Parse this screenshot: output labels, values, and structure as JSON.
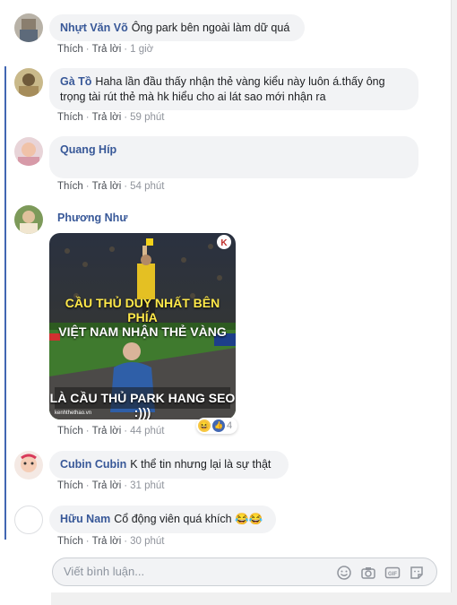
{
  "comments": [
    {
      "name": "Nhựt Văn Võ",
      "text": "Ông park bên ngoài làm dữ quá",
      "like": "Thích",
      "reply": "Trả lời",
      "time": "1 giờ"
    },
    {
      "name": "Gà Tồ",
      "text": "Haha lần đầu thấy nhận thẻ vàng kiểu này luôn á.thấy ông",
      "text2": "trọng tài rút thẻ mà hk hiểu cho ai lát sao mới nhận ra",
      "like": "Thích",
      "reply": "Trả lời",
      "time": "59 phút"
    },
    {
      "name": "Quang Híp",
      "text": "",
      "like": "Thích",
      "reply": "Trả lời",
      "time": "54 phút"
    },
    {
      "name": "Phương Như",
      "like": "Thích",
      "reply": "Trả lời",
      "time": "44 phút",
      "reaction_count": "4",
      "image": {
        "caption_top1": "CẦU THỦ DUY NHẤT BÊN PHÍA",
        "caption_top2": "VIỆT NAM NHẬN THẺ VÀNG",
        "caption_bottom": "LÀ CẦU THỦ PARK HANG SEO :)))",
        "watermark": "kenhthethao.vn"
      }
    },
    {
      "name": "Cubin Cubin",
      "text": "K thể tin nhưng lại là sự thật",
      "like": "Thích",
      "reply": "Trả lời",
      "time": "31 phút"
    },
    {
      "name": "Hữu Nam",
      "text": "Cổ động viên quá khích",
      "emoji": "😂😂",
      "like": "Thích",
      "reply": "Trả lời",
      "time": "30 phút"
    }
  ],
  "composer": {
    "placeholder": "Viết bình luận..."
  }
}
